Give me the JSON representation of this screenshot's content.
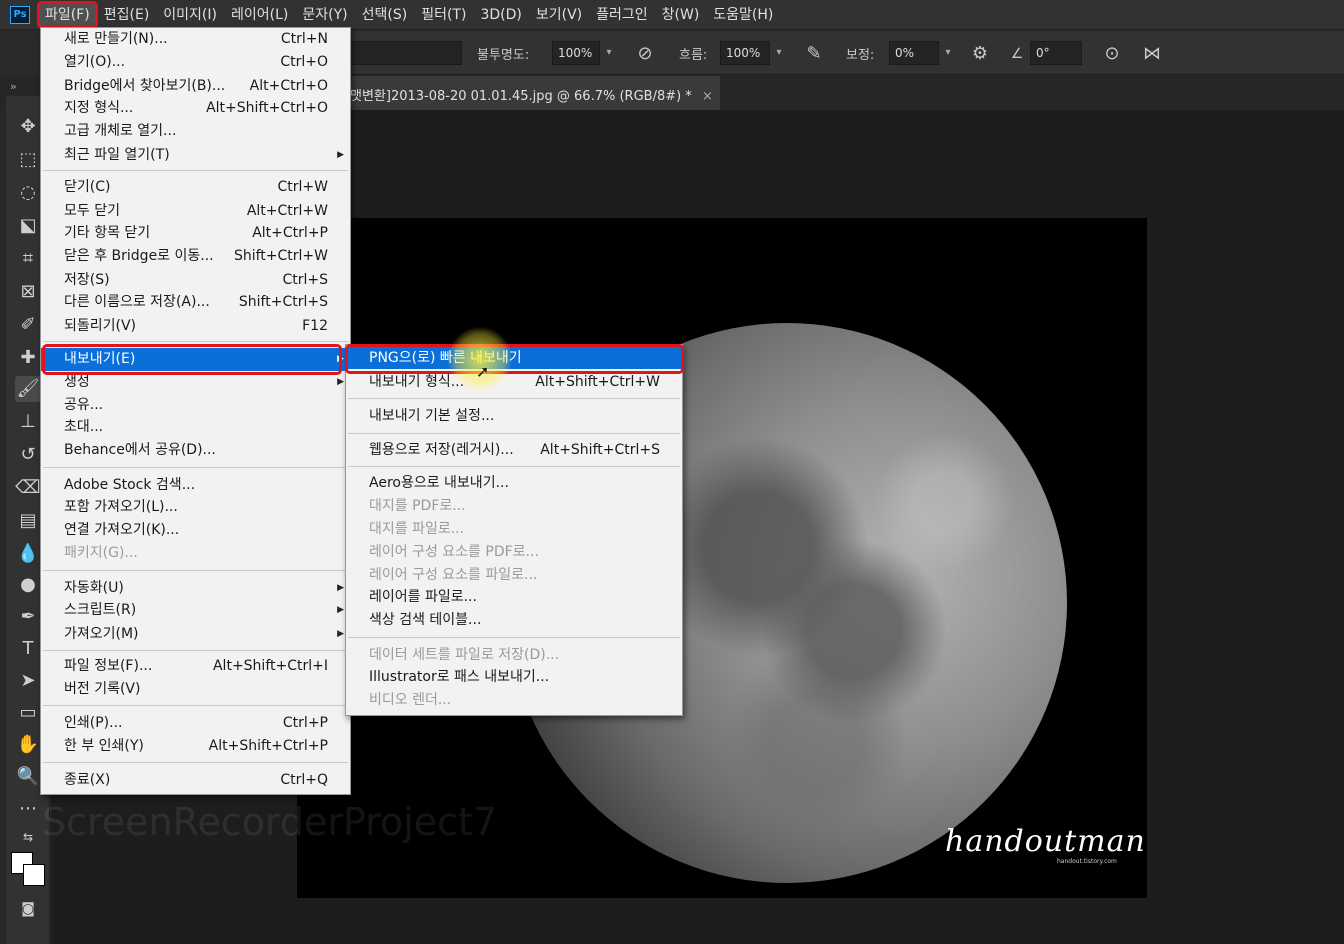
{
  "app": {
    "logo": "Ps"
  },
  "menubar": {
    "items": [
      "파일(F)",
      "편집(E)",
      "이미지(I)",
      "레이어(L)",
      "문자(Y)",
      "선택(S)",
      "필터(T)",
      "3D(D)",
      "보기(V)",
      "플러그인",
      "창(W)",
      "도움말(H)"
    ],
    "active": "파일(F)"
  },
  "options": {
    "opacity_label": "불투명도:",
    "opacity_value": "100%",
    "flow_label": "흐름:",
    "flow_value": "100%",
    "smoothing_label": "보정:",
    "smoothing_value": "0%",
    "angle_value": "0°"
  },
  "tabbar": {
    "doc_title": "맷변환]2013-08-20 01.01.45.jpg @ 66.7% (RGB/8#) *",
    "close": "×"
  },
  "expand": "»",
  "file_menu": {
    "items": [
      {
        "label": "새로 만들기(N)...",
        "shortcut": "Ctrl+N"
      },
      {
        "label": "열기(O)...",
        "shortcut": "Ctrl+O"
      },
      {
        "label": "Bridge에서 찾아보기(B)...",
        "shortcut": "Alt+Ctrl+O"
      },
      {
        "label": "지정 형식...",
        "shortcut": "Alt+Shift+Ctrl+O"
      },
      {
        "label": "고급 개체로 열기...",
        "shortcut": ""
      },
      {
        "label": "최근 파일 열기(T)",
        "shortcut": ""
      },
      {
        "label": "닫기(C)",
        "shortcut": "Ctrl+W"
      },
      {
        "label": "모두 닫기",
        "shortcut": "Alt+Ctrl+W"
      },
      {
        "label": "기타 항목 닫기",
        "shortcut": "Alt+Ctrl+P"
      },
      {
        "label": "닫은 후 Bridge로 이동...",
        "shortcut": "Shift+Ctrl+W"
      },
      {
        "label": "저장(S)",
        "shortcut": "Ctrl+S"
      },
      {
        "label": "다른 이름으로 저장(A)...",
        "shortcut": "Shift+Ctrl+S"
      },
      {
        "label": "되돌리기(V)",
        "shortcut": "F12"
      },
      {
        "label": "내보내기(E)",
        "shortcut": ""
      },
      {
        "label": "생성",
        "shortcut": ""
      },
      {
        "label": "공유...",
        "shortcut": ""
      },
      {
        "label": "초대...",
        "shortcut": ""
      },
      {
        "label": "Behance에서 공유(D)...",
        "shortcut": ""
      },
      {
        "label": "Adobe Stock 검색...",
        "shortcut": ""
      },
      {
        "label": "포함 가져오기(L)...",
        "shortcut": ""
      },
      {
        "label": "연결 가져오기(K)...",
        "shortcut": ""
      },
      {
        "label": "패키지(G)...",
        "shortcut": ""
      },
      {
        "label": "자동화(U)",
        "shortcut": ""
      },
      {
        "label": "스크립트(R)",
        "shortcut": ""
      },
      {
        "label": "가져오기(M)",
        "shortcut": ""
      },
      {
        "label": "파일 정보(F)...",
        "shortcut": "Alt+Shift+Ctrl+I"
      },
      {
        "label": "버전 기록(V)",
        "shortcut": ""
      },
      {
        "label": "인쇄(P)...",
        "shortcut": "Ctrl+P"
      },
      {
        "label": "한 부 인쇄(Y)",
        "shortcut": "Alt+Shift+Ctrl+P"
      },
      {
        "label": "종료(X)",
        "shortcut": "Ctrl+Q"
      }
    ]
  },
  "export_menu": {
    "items": [
      {
        "label": "PNG으(로) 빠른 내보내기",
        "shortcut": ""
      },
      {
        "label": "내보내기 형식...",
        "shortcut": "Alt+Shift+Ctrl+W"
      },
      {
        "label": "내보내기 기본 설정...",
        "shortcut": ""
      },
      {
        "label": "웹용으로 저장(레거시)...",
        "shortcut": "Alt+Shift+Ctrl+S"
      },
      {
        "label": "Aero용으로 내보내기...",
        "shortcut": ""
      },
      {
        "label": "대지를 PDF로...",
        "shortcut": ""
      },
      {
        "label": "대지를 파일로...",
        "shortcut": ""
      },
      {
        "label": "레이어 구성 요소를 PDF로...",
        "shortcut": ""
      },
      {
        "label": "레이어 구성 요소를 파일로...",
        "shortcut": ""
      },
      {
        "label": "레이어를 파일로...",
        "shortcut": ""
      },
      {
        "label": "색상 검색 테이블...",
        "shortcut": ""
      },
      {
        "label": "데이터 세트를 파일로 저장(D)...",
        "shortcut": ""
      },
      {
        "label": "Illustrator로 패스 내보내기...",
        "shortcut": ""
      },
      {
        "label": "비디오 렌더...",
        "shortcut": ""
      }
    ]
  },
  "image": {
    "watermark": "handoutman",
    "watermark_sub": "handout.tistory.com"
  },
  "recorder_watermark": "ScreenRecorderProject7"
}
